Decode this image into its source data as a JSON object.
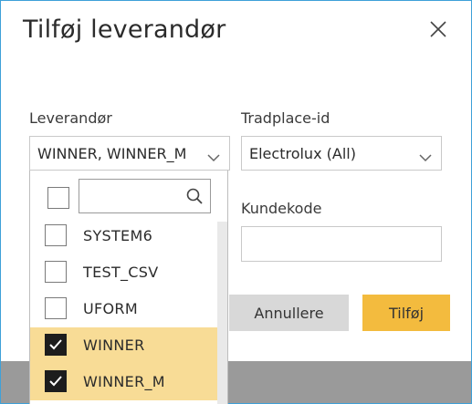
{
  "dialog": {
    "title": "Tilføj leverandør",
    "close_icon": "close-icon"
  },
  "fields": {
    "supplier_label": "Leverandør",
    "supplier_value": "WINNER, WINNER_M",
    "tradplace_label": "Tradplace-id",
    "tradplace_value": "Electrolux (All)",
    "customer_code_label": "Kundekode",
    "customer_code_value": ""
  },
  "buttons": {
    "cancel": "Annullere",
    "add": "Tilføj"
  },
  "dropdown": {
    "search_placeholder": "",
    "items": [
      {
        "label": "SYSTEM6",
        "checked": false
      },
      {
        "label": "TEST_CSV",
        "checked": false
      },
      {
        "label": "UFORM",
        "checked": false
      },
      {
        "label": "WINNER",
        "checked": true
      },
      {
        "label": "WINNER_M",
        "checked": true
      }
    ]
  },
  "colors": {
    "accent_button": "#f3bb3e",
    "selected_row": "#f8dc96",
    "frame_border": "#3ea0d8"
  }
}
